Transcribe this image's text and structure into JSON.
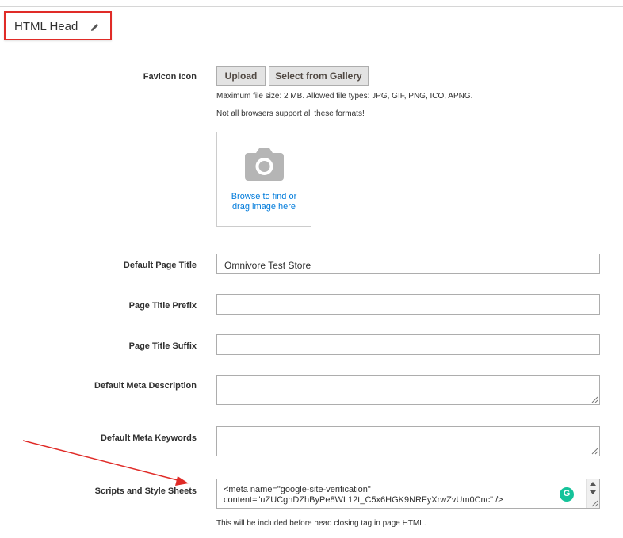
{
  "section": {
    "title": "HTML Head"
  },
  "favicon": {
    "label": "Favicon Icon",
    "upload_label": "Upload",
    "gallery_label": "Select from Gallery",
    "note_size": "Maximum file size: 2 MB. Allowed file types: JPG, GIF, PNG, ICO, APNG.",
    "note_support": "Not all browsers support all these formats!",
    "dropzone_line1": "Browse to find or",
    "dropzone_line2": "drag image here",
    "icon": "camera-icon"
  },
  "fields": {
    "default_title": {
      "label": "Default Page Title",
      "value": "Omnivore Test Store"
    },
    "title_prefix": {
      "label": "Page Title Prefix",
      "value": ""
    },
    "title_suffix": {
      "label": "Page Title Suffix",
      "value": ""
    },
    "meta_description": {
      "label": "Default Meta Description",
      "value": ""
    },
    "meta_keywords": {
      "label": "Default Meta Keywords",
      "value": ""
    },
    "scripts": {
      "label": "Scripts and Style Sheets",
      "line1": "<meta name=\"google-site-verification\"",
      "line2": "content=\"uZUCghDZhByPe8WL12t_C5x6HGK9NRFyXrwZvUm0Cnc\" />",
      "note": "This will be included before head closing tag in page HTML."
    }
  },
  "grammarly": {
    "glyph": "G",
    "color": "#15c39a"
  },
  "colors": {
    "highlight": "#e02b27",
    "link": "#007bdb"
  }
}
